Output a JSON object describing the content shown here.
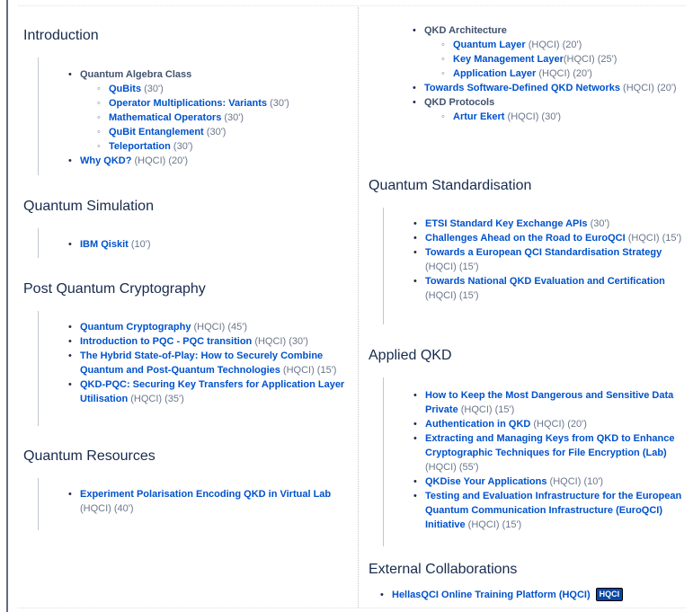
{
  "left_sections": [
    {
      "title": "Introduction",
      "items": [
        {
          "text": "Quantum Algebra Class",
          "kind": "heading",
          "children": [
            {
              "link": "QuBits",
              "meta": " (30')"
            },
            {
              "link": "Operator Multiplications: Variants",
              "meta": " (30')"
            },
            {
              "link": "Mathematical Operators",
              "meta": " (30')"
            },
            {
              "link": "QuBit Entanglement",
              "meta": " (30')"
            },
            {
              "link": "Teleportation",
              "meta": " (30')"
            }
          ]
        },
        {
          "link": "Why QKD?",
          "meta": " (HQCI) (20')"
        }
      ]
    },
    {
      "title": "Quantum Simulation",
      "items": [
        {
          "link": "IBM Qiskit",
          "meta": " (10')"
        }
      ]
    },
    {
      "title": "Post Quantum Cryptography",
      "items": [
        {
          "link": "Quantum Cryptography",
          "meta": " (HQCI) (45')"
        },
        {
          "link": "Introduction to PQC - PQC transition",
          "meta": " (HQCI) (30')"
        },
        {
          "link": "The Hybrid State-of-Play: How to Securely Combine Quantum and Post-Quantum Technologies",
          "meta": " (HQCI) (15')"
        },
        {
          "link": "QKD-PQC: Securing Key Transfers for Application Layer Utilisation",
          "meta": " (HQCI) (35')"
        }
      ]
    },
    {
      "title": "Quantum Resources",
      "items": [
        {
          "link": "Experiment Polarisation Encoding QKD in Virtual Lab",
          "meta": " (HQCI) (40')"
        }
      ]
    }
  ],
  "right_top": {
    "items": [
      {
        "text": "QKD Architecture",
        "kind": "heading",
        "children": [
          {
            "link": "Quantum Layer",
            "meta": " (HQCI) (20')"
          },
          {
            "link": "Key Management Layer",
            "meta": "(HQCI) (25')"
          },
          {
            "link": "Application Layer",
            "meta": " (HQCI) (20')"
          }
        ]
      },
      {
        "link": "Towards Software-Defined QKD Networks",
        "meta": " (HQCI) (20')"
      },
      {
        "text": "QKD Protocols",
        "kind": "heading",
        "children": [
          {
            "link": "Artur Ekert",
            "meta": " (HQCI) (30')"
          }
        ]
      }
    ]
  },
  "right_sections": [
    {
      "title": "Quantum Standardisation",
      "items": [
        {
          "link": "ETSI Standard Key Exchange APIs",
          "meta": " (30')"
        },
        {
          "link": "Challenges Ahead on the Road to EuroQCI",
          "meta": " (HQCI) (15')"
        },
        {
          "link": "Towards a European QCI Standardisation Strategy",
          "meta": " (HQCI) (15')"
        },
        {
          "link": "Towards National QKD Evaluation and Certification",
          "meta": " (HQCI) (15')"
        }
      ]
    },
    {
      "title": "Applied QKD",
      "items": [
        {
          "link": "How to Keep the Most Dangerous and Sensitive Data Private",
          "meta": " (HQCI) (15')"
        },
        {
          "link": "Authentication in QKD",
          "meta": " (HQCI) (20')"
        },
        {
          "link": "Extracting and Managing Keys from QKD to Enhance Cryptographic Techniques for File Encryption (Lab)",
          "meta": " (HQCI) (55')"
        },
        {
          "link": "QKDise Your Applications",
          "meta": " (HQCI) (10')"
        },
        {
          "link": "Testing and Evaluation Infrastructure for the European Quantum Communication Infrastructure (EuroQCI) Initiative",
          "meta": " (HQCI) (15')"
        }
      ]
    },
    {
      "title": "External Collaborations",
      "items": [
        {
          "link": "HellasQCI Online Training Platform (HQCI)",
          "meta": "",
          "badge": "HQCI"
        }
      ]
    }
  ]
}
